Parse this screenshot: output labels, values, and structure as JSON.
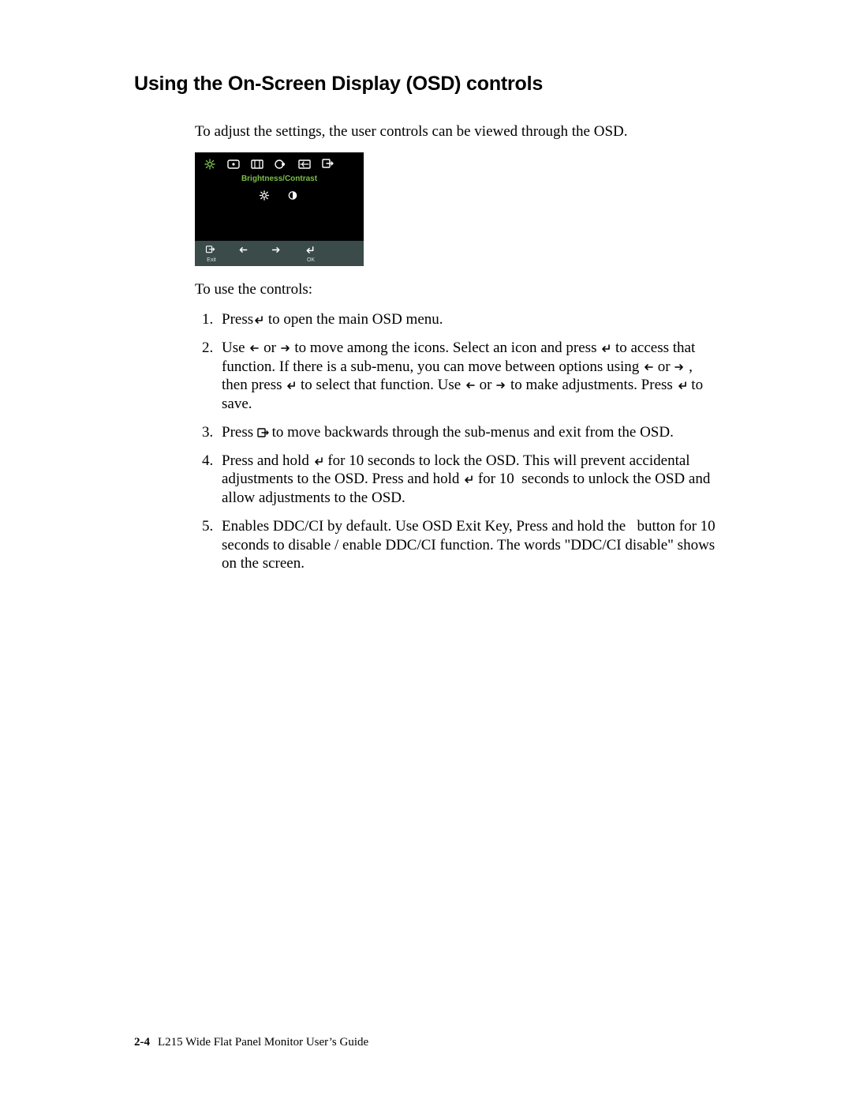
{
  "heading": "Using the On-Screen Display (OSD) controls",
  "intro": "To adjust the settings, the user controls can be viewed through the OSD.",
  "osd": {
    "title": "Brightness/Contrast",
    "bottom": {
      "exit": "Exit",
      "ok": "OK"
    }
  },
  "lead": "To use the controls:",
  "steps": {
    "s1a": "Press",
    "s1b": " to open the main OSD menu.",
    "s2a": "Use ",
    "s2b": " or ",
    "s2c": " to move among the icons. Select an icon and press ",
    "s2d": " to access that function. If there is a sub-menu, you can move between options using ",
    "s2e": " or ",
    "s2f": " , then press ",
    "s2g": " to select that function. Use ",
    "s2h": " or ",
    "s2i": " to make adjustments. Press ",
    "s2j": " to save.",
    "s3a": "Press ",
    "s3b": " to move backwards through the sub-menus and exit from the OSD.",
    "s4a": "Press and hold ",
    "s4b": " for 10 seconds to lock the OSD. This will prevent accidental adjustments to the OSD. Press and hold ",
    "s4c": " for 10  seconds to unlock the OSD and allow adjustments to the OSD.",
    "s5": "Enables DDC/CI by default. Use OSD Exit Key, Press and hold the   button for 10 seconds to disable / enable DDC/CI function. The words \"DDC/CI disable\" shows on the screen."
  },
  "footer": {
    "page": "2-4",
    "title": "L215 Wide Flat Panel Monitor User’s Guide"
  }
}
